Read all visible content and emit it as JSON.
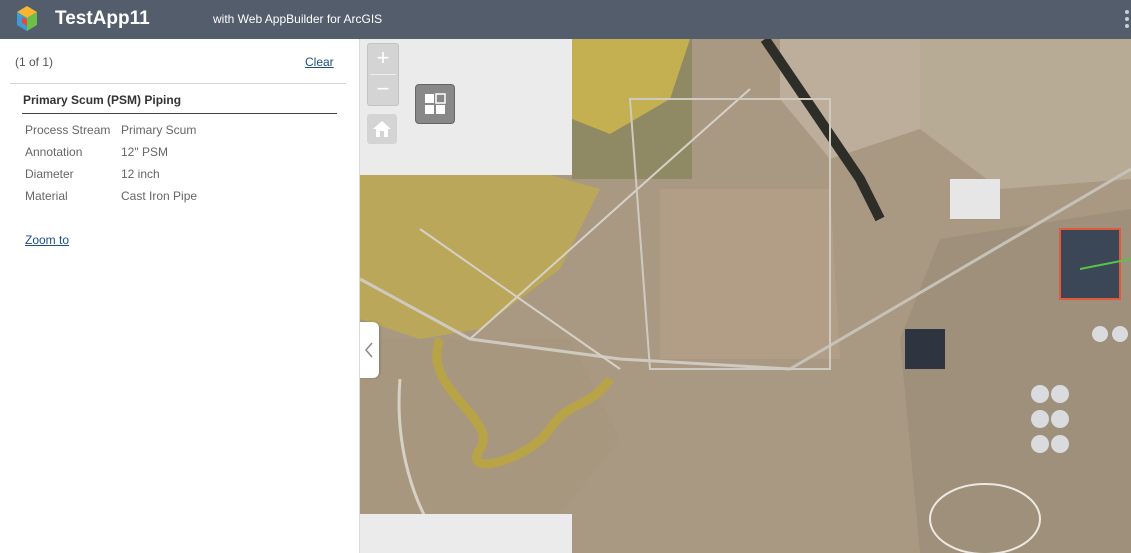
{
  "header": {
    "title": "TestApp11",
    "subtitle": "with Web AppBuilder for ArcGIS"
  },
  "popup": {
    "count": "(1 of 1)",
    "clear_label": "Clear",
    "feature_title": "Primary Scum (PSM) Piping",
    "attributes": [
      {
        "key": "Process Stream",
        "value": "Primary Scum"
      },
      {
        "key": "Annotation",
        "value": "12\" PSM"
      },
      {
        "key": "Diameter",
        "value": "12 inch"
      },
      {
        "key": "Material",
        "value": "Cast Iron Pipe"
      }
    ],
    "zoom_label": "Zoom to"
  },
  "map_controls": {
    "zoom_in": "+",
    "zoom_out": "−",
    "home_icon": "home-icon",
    "basemap_icon": "basemap-gallery-icon",
    "collapse_icon": "chevron-left-icon"
  },
  "colors": {
    "header_bg": "#535d6b",
    "link": "#1b4e8a",
    "control_bg": "#d4d4d4"
  }
}
